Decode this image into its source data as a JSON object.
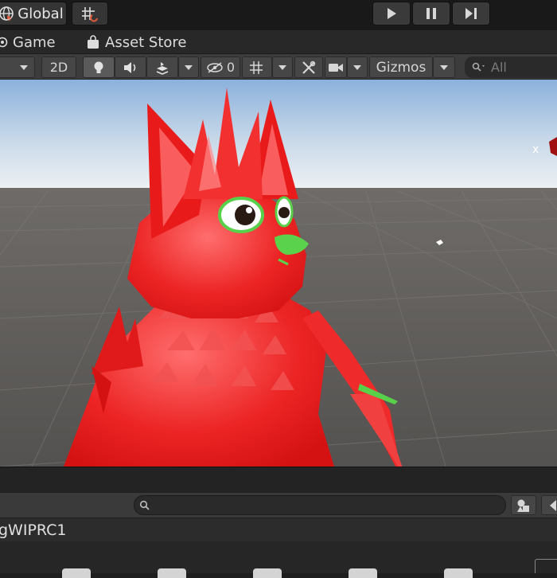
{
  "toolbar": {
    "global_label": "Global"
  },
  "tabs": [
    {
      "label": "Game"
    },
    {
      "label": "Asset Store"
    }
  ],
  "scene_toolbar": {
    "mode_2d": "2D",
    "hidden_count": "0",
    "gizmos_label": "Gizmos",
    "search_placeholder": "All"
  },
  "viewport": {
    "axis_label": "x"
  },
  "bottom": {
    "object_name": "gWIPRC1"
  },
  "colors": {
    "model": "#e81a1a",
    "selection_outline": "#4cd24c",
    "ground": "#5a5856",
    "sky_top": "#8fb4dd",
    "sky_horizon": "#e8eef3"
  }
}
